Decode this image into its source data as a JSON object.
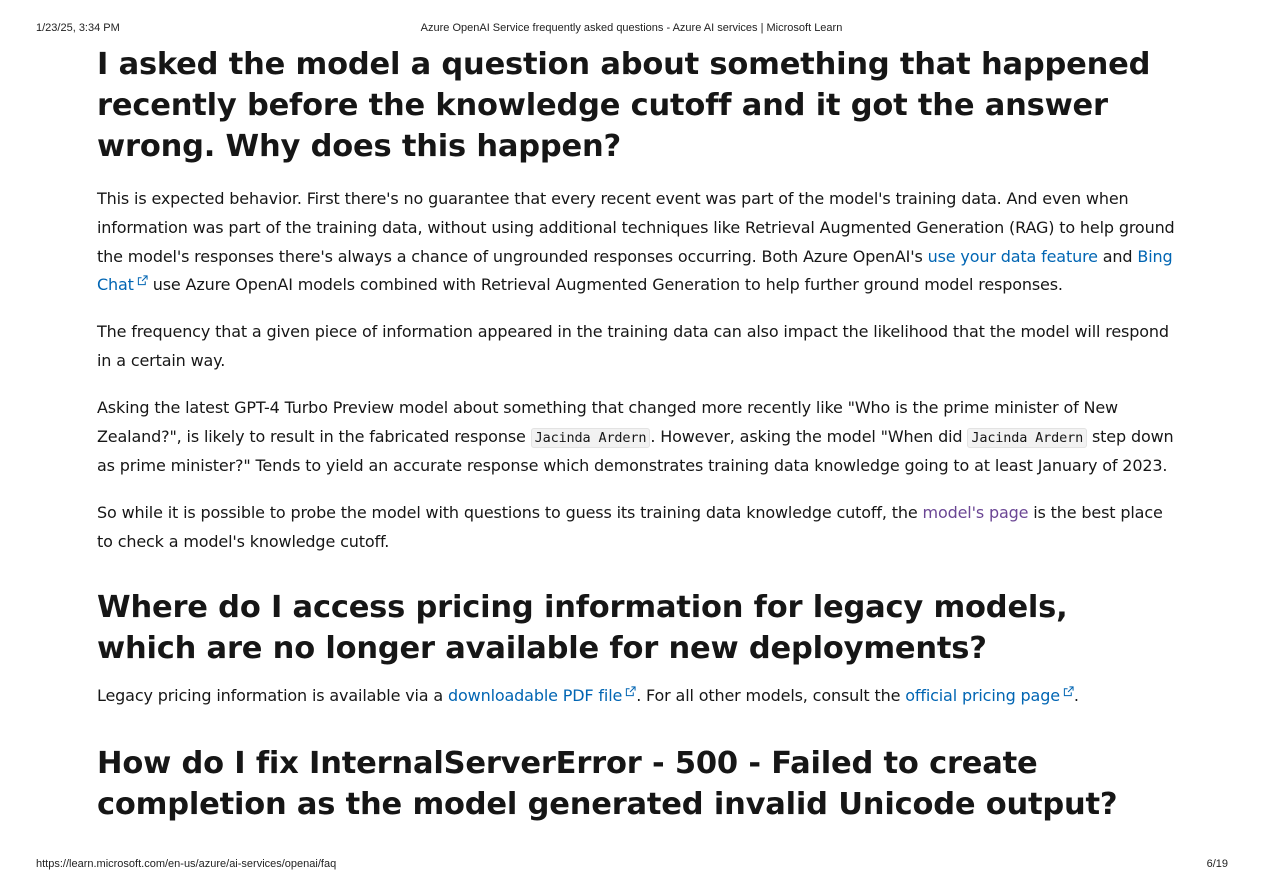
{
  "print_header": {
    "datetime": "1/23/25, 3:34 PM",
    "doc_title": "Azure OpenAI Service frequently asked questions - Azure AI services | Microsoft Learn"
  },
  "print_footer": {
    "url": "https://learn.microsoft.com/en-us/azure/ai-services/openai/faq",
    "page": "6/19"
  },
  "sections": {
    "knowledge_cutoff": {
      "heading": "I asked the model a question about something that happened recently before the knowledge cutoff and it got the answer wrong. Why does this happen?",
      "p1_text_a": "This is expected behavior. First there's no guarantee that every recent event was part of the model's training data. And even when information was part of the training data, without using additional techniques like Retrieval Augmented Generation (RAG) to help ground the model's responses there's always a chance of ungrounded responses occurring. Both Azure OpenAI's ",
      "p1_link_data": "use your data feature",
      "p1_text_b": " and ",
      "p1_link_bing": "Bing Chat",
      "p1_text_c": " use Azure OpenAI models combined with Retrieval Augmented Generation to help further ground model responses.",
      "p2_text": "The frequency that a given piece of information appeared in the training data can also impact the likelihood that the model will respond in a certain way.",
      "p3_text_a": "Asking the latest GPT-4 Turbo Preview model about something that changed more recently like \"Who is the prime minister of New Zealand?\", is likely to result in the fabricated response ",
      "p3_code_1": "Jacinda Ardern",
      "p3_text_b": ". However, asking the model \"When did ",
      "p3_code_2": "Jacinda Ardern",
      "p3_text_c": " step down as prime minister?\" Tends to yield an accurate response which demonstrates training data knowledge going to at least January of 2023.",
      "p4_text_a": "So while it is possible to probe the model with questions to guess its training data knowledge cutoff, the ",
      "p4_link_models": "model's page",
      "p4_text_b": " is the best place to check a model's knowledge cutoff."
    },
    "legacy_pricing": {
      "heading": "Where do I access pricing information for legacy models, which are no longer available for new deployments?",
      "text_a": "Legacy pricing information is available via a ",
      "link_pdf": "downloadable PDF file",
      "text_b": ". For all other models, consult the ",
      "link_pricing": "official pricing page",
      "text_c": "."
    },
    "internal_server_error": {
      "heading": "How do I fix InternalServerError - 500 - Failed to create completion as the model generated invalid Unicode output?"
    }
  },
  "colors": {
    "link": "#0065b3",
    "visited_link": "#6b4694",
    "text": "#161616"
  },
  "icons": {
    "external_link": "external-link-icon"
  }
}
